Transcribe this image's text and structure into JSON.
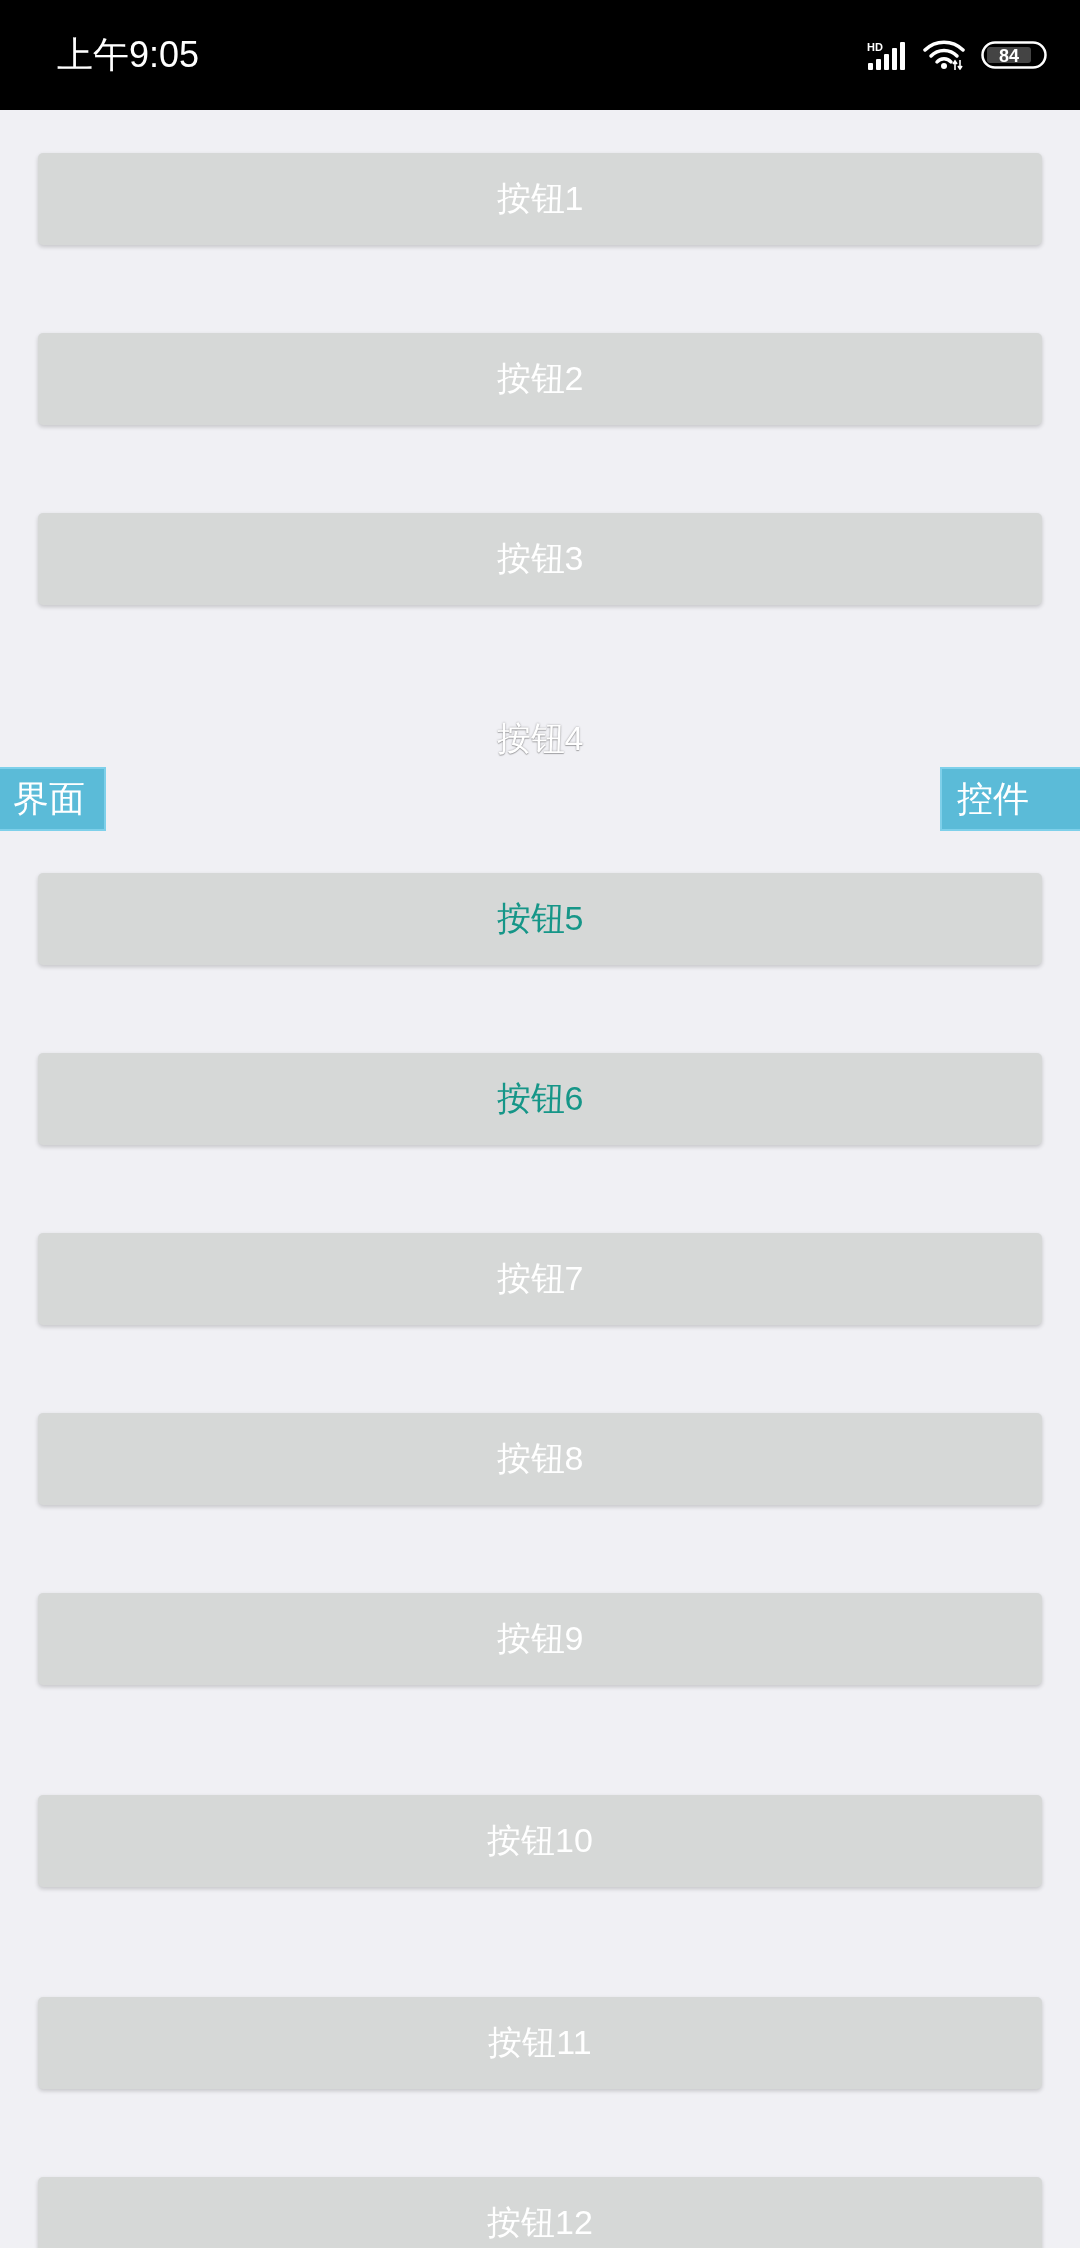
{
  "status_bar": {
    "time": "上午9:05",
    "network": "HD",
    "battery": "84"
  },
  "buttons": [
    {
      "label": "按钮1",
      "kind": "raised",
      "color": "#ffffff"
    },
    {
      "label": "按钮2",
      "kind": "raised",
      "color": "#ffffff"
    },
    {
      "label": "按钮3",
      "kind": "raised",
      "color": "#ffffff"
    },
    {
      "label": "按钮4",
      "kind": "flat",
      "color": "#ffffff"
    },
    {
      "label": "按钮5",
      "kind": "raised",
      "color": "#169688"
    },
    {
      "label": "按钮6",
      "kind": "raised",
      "color": "#169688"
    },
    {
      "label": "按钮7",
      "kind": "raised",
      "color": "#ffffff"
    },
    {
      "label": "按钮8",
      "kind": "raised",
      "color": "#ffffff"
    },
    {
      "label": "按钮9",
      "kind": "raised",
      "color": "#ffffff"
    },
    {
      "label": "按钮10",
      "kind": "raised",
      "color": "#ffffff"
    },
    {
      "label": "按钮11",
      "kind": "raised",
      "color": "#ffffff"
    },
    {
      "label": "按钮12",
      "kind": "raised",
      "color": "#ffffff"
    }
  ],
  "edge_tabs": {
    "left": "界面",
    "right": "控件"
  }
}
